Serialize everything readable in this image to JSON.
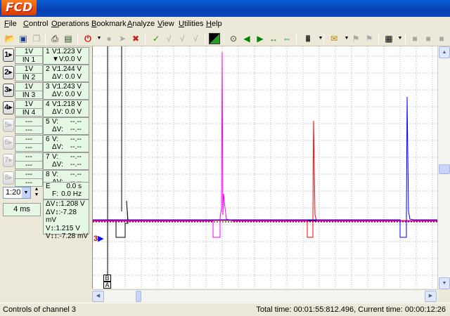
{
  "app": {
    "logo": "FCD"
  },
  "menu": [
    {
      "label": "File",
      "u": "F",
      "rest": "ile"
    },
    {
      "label": "Control",
      "u": "C",
      "rest": "ontrol"
    },
    {
      "label": "Operations",
      "u": "O",
      "rest": "perations"
    },
    {
      "label": "Bookmark",
      "u": "B",
      "rest": "ookmark"
    },
    {
      "label": "Analyze",
      "u": "A",
      "rest": "nalyze"
    },
    {
      "label": "View",
      "u": "V",
      "rest": "iew"
    },
    {
      "label": "Utilities",
      "u": "U",
      "rest": "tilities"
    },
    {
      "label": "Help",
      "u": "H",
      "rest": "elp"
    }
  ],
  "channels": [
    {
      "id": "1",
      "scale": "1V",
      "input": "IN 1",
      "volt_label": "V:",
      "volt": "1.223 V",
      "delta_label": "▼V:",
      "delta": "0.0 V",
      "enabled": true
    },
    {
      "id": "2",
      "scale": "1V",
      "input": "IN 2",
      "volt_label": "V:",
      "volt": "1.244 V",
      "delta_label": "ΔV:",
      "delta": "0.0 V",
      "enabled": true
    },
    {
      "id": "3",
      "scale": "1V",
      "input": "IN 3",
      "volt_label": "V:",
      "volt": "1.243 V",
      "delta_label": "ΔV:",
      "delta": "0.0 V",
      "enabled": true
    },
    {
      "id": "4",
      "scale": "1V",
      "input": "IN 4",
      "volt_label": "V:",
      "volt": "1.218 V",
      "delta_label": "ΔV:",
      "delta": "0.0 V",
      "enabled": true
    },
    {
      "id": "5",
      "scale": "---",
      "input": "---",
      "volt_label": "V:",
      "volt": "--.--",
      "delta_label": "ΔV:",
      "delta": "--.--",
      "enabled": false
    },
    {
      "id": "6",
      "scale": "---",
      "input": "---",
      "volt_label": "V:",
      "volt": "--.--",
      "delta_label": "ΔV:",
      "delta": "--.--",
      "enabled": false
    },
    {
      "id": "7",
      "scale": "---",
      "input": "---",
      "volt_label": "V:",
      "volt": "--.--",
      "delta_label": "ΔV:",
      "delta": "--.--",
      "enabled": false
    },
    {
      "id": "8",
      "scale": "---",
      "input": "---",
      "volt_label": "V:",
      "volt": "--.--",
      "delta_label": "ΔV:",
      "delta": "--.--",
      "enabled": false
    }
  ],
  "timebase": {
    "select": "1:20",
    "value": "4 ms"
  },
  "measurement": {
    "e_label": "E",
    "e_value": "0.0 s",
    "f_label": "F:",
    "f_value": "0.0 Hz"
  },
  "cursors": [
    "ΔV↕:1.208 V",
    "ΔV↕:-7.28 mV",
    "V↕:1.215 V",
    "V↕↕:-7.28 mV"
  ],
  "markers": {
    "a": "A",
    "b": "B"
  },
  "status": {
    "left": "Controls of channel 3",
    "right": "Total time: 00:01:55:812.496, Current time: 00:00:12:26"
  },
  "trace_colors": {
    "ch1": "#000000",
    "ch2": "#ff00ff",
    "ch3": "#ff0000",
    "ch4": "#0000ff"
  }
}
